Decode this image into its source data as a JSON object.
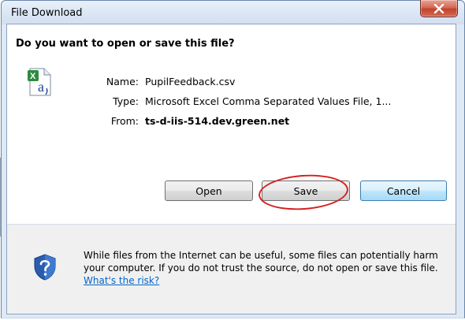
{
  "window": {
    "title": "File Download",
    "close_symbol": "X"
  },
  "dialog": {
    "question": "Do you want to open or save this file?",
    "file_icon": "excel-csv-file-icon",
    "fields": {
      "name_label": "Name:",
      "name_value": "PupilFeedback.csv",
      "type_label": "Type:",
      "type_value": "Microsoft Excel Comma Separated Values File, 1...",
      "from_label": "From:",
      "from_value": "ts-d-iis-514.dev.green.net"
    },
    "buttons": {
      "open": "Open",
      "save": "Save",
      "cancel": "Cancel"
    }
  },
  "warning": {
    "icon": "shield-question-icon",
    "text": "While files from the Internet can be useful, some files can potentially harm your computer. If you do not trust the source, do not open or save this file.",
    "link": "What's the risk?"
  },
  "colors": {
    "annotation_ellipse": "#d42020",
    "link": "#0066cc",
    "close_button": "#c2432c"
  }
}
